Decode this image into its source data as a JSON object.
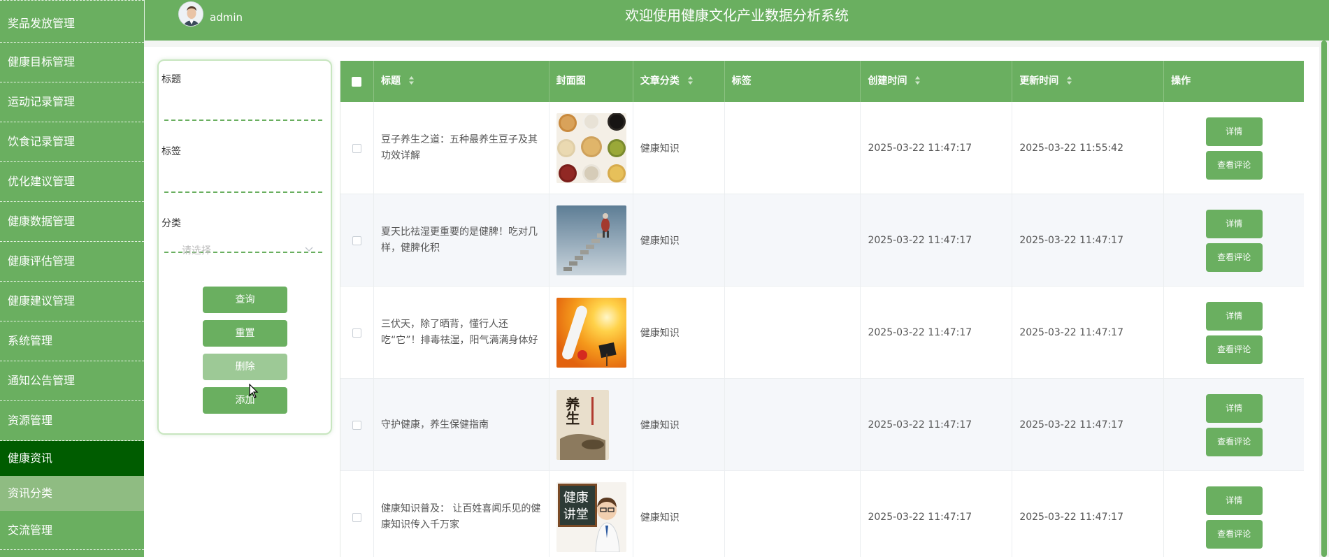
{
  "sidebar": {
    "items": [
      {
        "label": "奖品发放管理"
      },
      {
        "label": "健康目标管理"
      },
      {
        "label": "运动记录管理"
      },
      {
        "label": "饮食记录管理"
      },
      {
        "label": "优化建议管理"
      },
      {
        "label": "健康数据管理"
      },
      {
        "label": "健康评估管理"
      },
      {
        "label": "健康建议管理"
      },
      {
        "label": "系统管理"
      },
      {
        "label": "通知公告管理"
      },
      {
        "label": "资源管理"
      }
    ],
    "active": {
      "label": "健康资讯"
    },
    "sub": {
      "label": "资讯分类"
    },
    "after": {
      "label": "交流管理"
    }
  },
  "header": {
    "username": "admin",
    "title": "欢迎使用健康文化产业数据分析系统"
  },
  "search": {
    "title_label": "标题",
    "tag_label": "标签",
    "category_label": "分类",
    "category_placeholder": "请选择",
    "query_btn": "查询",
    "reset_btn": "重置",
    "delete_btn": "删除",
    "add_btn": "添加"
  },
  "table": {
    "headers": [
      "标题",
      "封面图",
      "文章分类",
      "标签",
      "创建时间",
      "更新时间",
      "操作"
    ],
    "rows": [
      {
        "title": "豆子养生之道：五种最养生豆子及其功效详解",
        "cover": "beans-image",
        "category": "健康知识",
        "tag": "",
        "created": "2025-03-22 11:47:17",
        "updated": "2025-03-22 11:55:42",
        "detail_btn": "详情",
        "comment_btn": "查看评论"
      },
      {
        "title": "夏天比祛湿更重要的是健脾！吃对几样，健脾化积",
        "cover": "stairs-image",
        "category": "健康知识",
        "tag": "",
        "created": "2025-03-22 11:47:17",
        "updated": "2025-03-22 11:47:17",
        "detail_btn": "详情",
        "comment_btn": "查看评论"
      },
      {
        "title": "三伏天，除了晒背，懂行人还吃“它”！排毒祛湿，阳气满满身体好",
        "cover": "sun-thermometer-image",
        "category": "健康知识",
        "tag": "",
        "created": "2025-03-22 11:47:17",
        "updated": "2025-03-22 11:47:17",
        "detail_btn": "详情",
        "comment_btn": "查看评论"
      },
      {
        "title": "守护健康，养生保健指南",
        "cover": "yangsheng-image",
        "category": "健康知识",
        "tag": "",
        "created": "2025-03-22 11:47:17",
        "updated": "2025-03-22 11:47:17",
        "detail_btn": "详情",
        "comment_btn": "查看评论"
      },
      {
        "title": "健康知识普及： 让百姓喜闻乐见的健康知识传入千万家",
        "cover": "health-lecture-image",
        "category": "健康知识",
        "tag": "",
        "created": "2025-03-22 11:47:17",
        "updated": "2025-03-22 11:47:17",
        "detail_btn": "详情",
        "comment_btn": "查看评论"
      }
    ]
  },
  "images": {
    "yangsheng_text": "养生",
    "lecture_line1": "健康",
    "lecture_line2": "讲堂"
  },
  "colors": {
    "primary": "#6aaf60",
    "active": "#005c00",
    "sub": "#8fbc82"
  }
}
